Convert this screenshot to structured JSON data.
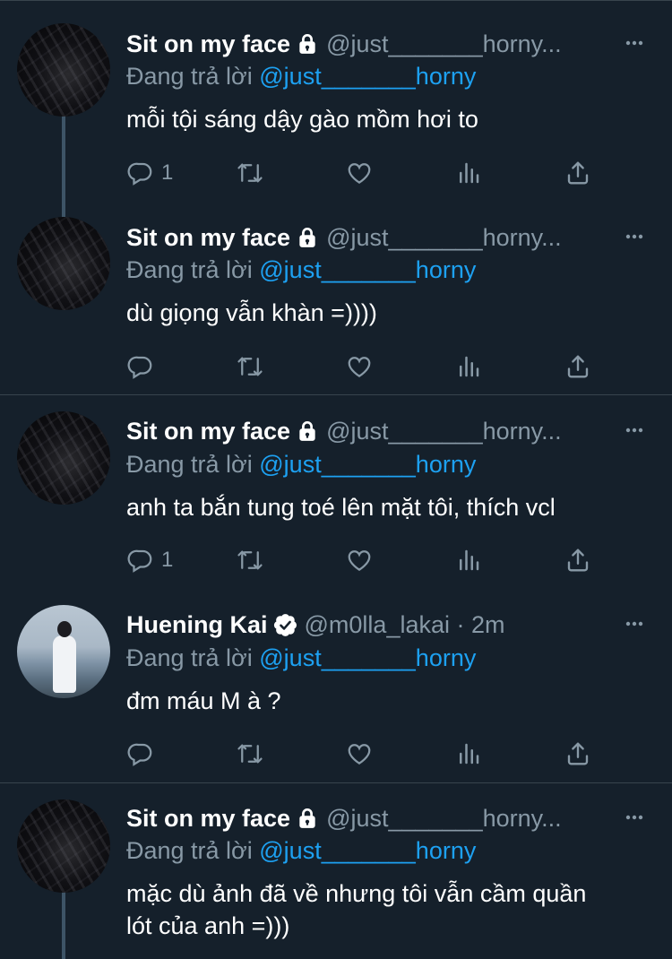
{
  "tweets": [
    {
      "name": "Sit on my face",
      "handle": "@just_______horny...",
      "replying_prefix": "Đang trả lời ",
      "replying_mention": "@just_______horny",
      "text": "mỗi tội sáng dậy gào mồm hơi to",
      "reply_count": "1",
      "locked": true
    },
    {
      "name": "Sit on my face",
      "handle": "@just_______horny...",
      "replying_prefix": "Đang trả lời ",
      "replying_mention": "@just_______horny",
      "text": "dù giọng vẫn khàn =))))",
      "reply_count": "",
      "locked": true
    },
    {
      "name": "Sit on my face",
      "handle": "@just_______horny...",
      "replying_prefix": "Đang trả lời ",
      "replying_mention": "@just_______horny",
      "text": "anh ta bắn tung toé lên mặt tôi, thích vcl",
      "reply_count": "1",
      "locked": true
    },
    {
      "name": "Huening Kai",
      "handle": "@m0lla_lakai · 2m",
      "replying_prefix": "Đang trả lời ",
      "replying_mention": "@just_______horny",
      "text": "đm máu M à ?",
      "reply_count": "",
      "verified": true
    },
    {
      "name": "Sit on my face",
      "handle": "@just_______horny...",
      "replying_prefix": "Đang trả lời ",
      "replying_mention": "@just_______horny",
      "text": "mặc dù ảnh đã về nhưng tôi vẫn cầm quần lót của anh =)))",
      "locked": true
    }
  ],
  "colors": {
    "background": "#15202b",
    "muted": "#8899a6",
    "mention": "#1da1f2",
    "divider": "#38444d"
  },
  "icons": [
    "reply-icon",
    "retweet-icon",
    "like-icon",
    "analytics-icon",
    "share-icon",
    "lock-icon",
    "verified-icon",
    "more-icon"
  ]
}
